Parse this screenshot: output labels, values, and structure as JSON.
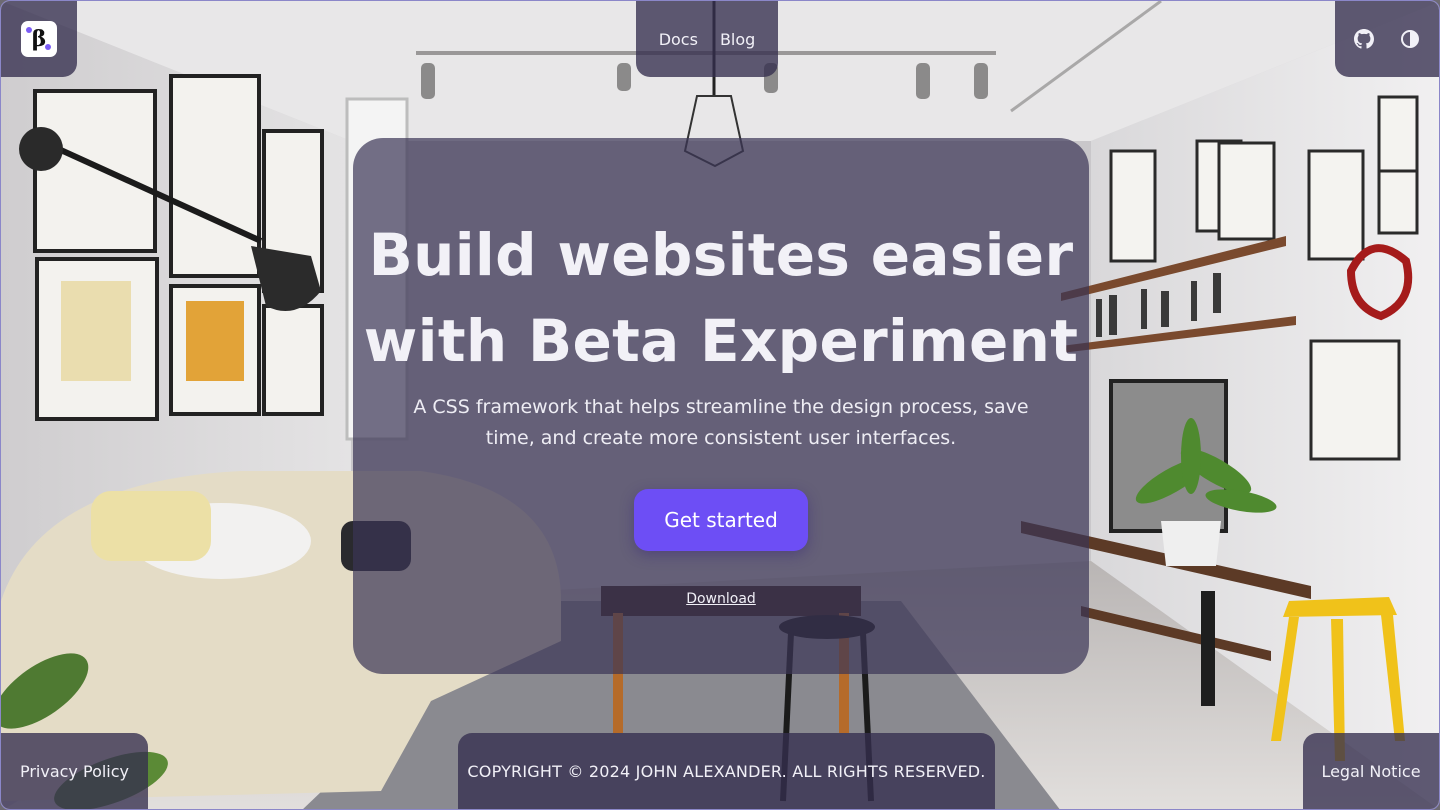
{
  "header": {
    "logo_glyph": "β",
    "nav": [
      {
        "label": "Docs"
      },
      {
        "label": "Blog"
      }
    ],
    "tools": {
      "github_icon": "github-icon",
      "theme_icon": "contrast-icon"
    }
  },
  "hero": {
    "title_line1": "Build websites easier",
    "title_line2": "with Beta Experiment",
    "subtitle": "A CSS framework that helps streamline the design process, save time, and create more consistent user interfaces.",
    "cta_label": "Get started",
    "download_label": "Download"
  },
  "footer": {
    "privacy": "Privacy Policy",
    "copyright": "COPYRIGHT © 2024 JOHN ALEXANDER. ALL RIGHTS RESERVED.",
    "legal": "Legal Notice"
  },
  "colors": {
    "accent": "#6d4ef5",
    "panel": "#342e4e",
    "text": "#f1f0f7"
  }
}
